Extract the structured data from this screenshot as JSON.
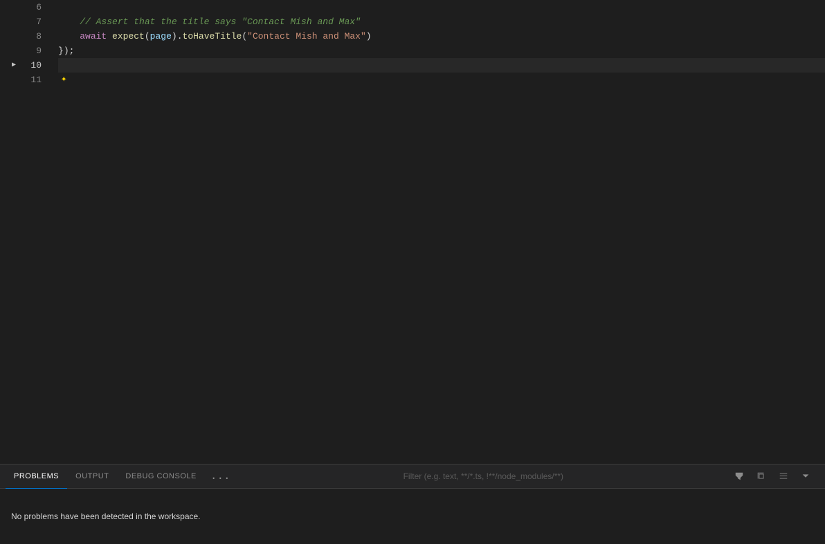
{
  "editor": {
    "background": "#1e1e1e",
    "lines": [
      {
        "number": 6,
        "content": "",
        "tokens": []
      },
      {
        "number": 7,
        "content": "    // Assert that the title says \"Contact Mish and Max\"",
        "tokens": [
          {
            "type": "comment",
            "text": "    // Assert that the title says \"Contact Mish and Max\""
          }
        ]
      },
      {
        "number": 8,
        "content": "    await expect(page).toHaveTitle(\"Contact Mish and Max\")",
        "tokens": [
          {
            "type": "plain",
            "text": "    "
          },
          {
            "type": "keyword",
            "text": "await"
          },
          {
            "type": "plain",
            "text": " "
          },
          {
            "type": "function",
            "text": "expect"
          },
          {
            "type": "punctuation",
            "text": "("
          },
          {
            "type": "variable",
            "text": "page"
          },
          {
            "type": "punctuation",
            "text": ")"
          },
          {
            "type": "plain",
            "text": "."
          },
          {
            "type": "method",
            "text": "toHaveTitle"
          },
          {
            "type": "punctuation",
            "text": "("
          },
          {
            "type": "string",
            "text": "\"Contact Mish and Max\""
          },
          {
            "type": "punctuation",
            "text": ")"
          }
        ]
      },
      {
        "number": 9,
        "content": "});",
        "tokens": [
          {
            "type": "plain",
            "text": "}"
          },
          {
            "type": "punctuation",
            "text": ");"
          }
        ]
      },
      {
        "number": 10,
        "content": "",
        "tokens": [],
        "active": true
      },
      {
        "number": 11,
        "content": "",
        "tokens": [],
        "hasSparkle": true
      }
    ]
  },
  "bottom_panel": {
    "tabs": [
      {
        "id": "problems",
        "label": "PROBLEMS",
        "active": true
      },
      {
        "id": "output",
        "label": "OUTPUT",
        "active": false
      },
      {
        "id": "debug_console",
        "label": "DEBUG CONSOLE",
        "active": false
      }
    ],
    "more_button": "...",
    "filter_placeholder": "Filter (e.g. text, **/*.ts, !**/node_modules/**)",
    "no_problems_text": "No problems have been detected in the workspace.",
    "actions": {
      "filter": "filter",
      "copy": "copy",
      "list": "list",
      "collapse": "collapse"
    }
  }
}
